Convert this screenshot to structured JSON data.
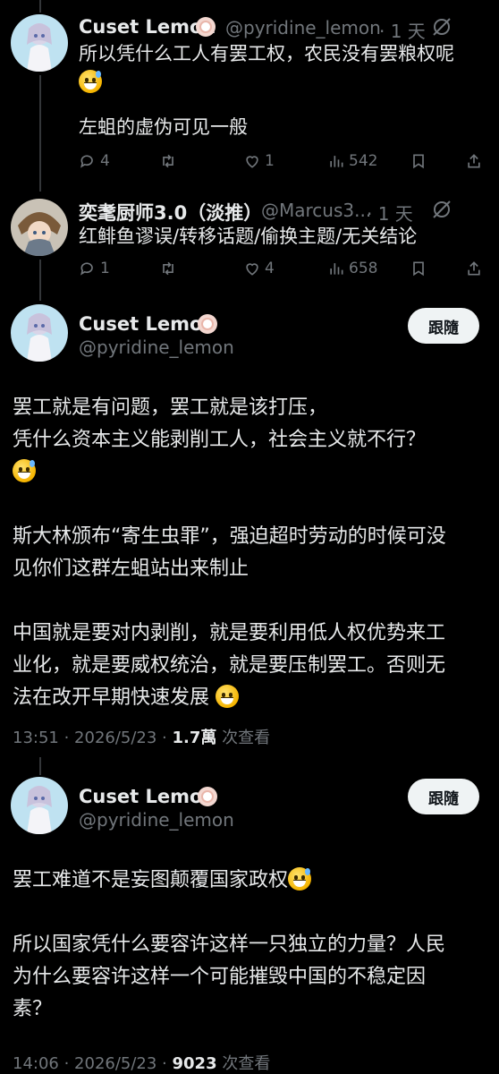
{
  "replies": [
    {
      "name": "Cuset Lemon",
      "handle": "@pyridine_lemon",
      "time": "· 1 天",
      "text_line1": "所以凭什么工人有罢工权，农民没有罢粮权呢",
      "text_line2": "左蛆的虚伪可见一般",
      "metrics": {
        "replies": "4",
        "retweets": "",
        "likes": "1",
        "views": "542"
      }
    },
    {
      "name": "奕耄厨师3.0（淡推）",
      "handle": "@Marcus3...",
      "time": "· 1 天",
      "text_line1": "红鲱鱼谬误/转移话题/偷换主题/无关结论",
      "metrics": {
        "replies": "1",
        "retweets": "",
        "likes": "4",
        "views": "658"
      }
    }
  ],
  "main_tweet": {
    "name": "Cuset Lemon",
    "handle": "@pyridine_lemon",
    "follow_label": "跟隨",
    "p1_line1": "罢工就是有问题，罢工就是该打压，",
    "p1_line2": "凭什么资本主义能剥削工人，社会主义就不行？",
    "p2_line1": "斯大林颁布“寄生虫罪”，强迫超时劳动的时候可没",
    "p2_line2": "见你们这群左蛆站出来制止",
    "p3_line1": "中国就是要对内剥削，就是要利用低人权优势来工",
    "p3_line2": "业化，就是要威权统治，就是要压制罢工。否则无",
    "p3_line3": "法在改开早期快速发展",
    "time": "13:51 · 2026/5/23 · ",
    "views": "1.7萬",
    "views_label": " 次查看"
  },
  "second_tweet": {
    "name": "Cuset Lemon",
    "handle": "@pyridine_lemon",
    "follow_label": "跟隨",
    "p1_line1": "罢工难道不是妄图颠覆国家政权",
    "p2_line1": "所以国家凭什么要容许这样一只独立的力量？人民",
    "p2_line2": "为什么要容许这样一个可能摧毁中国的不稳定因",
    "p2_line3": "素？",
    "time": "14:06 · 2026/5/23 · ",
    "views": "9023",
    "views_label": " 次查看"
  },
  "icons": [
    "reply-icon",
    "retweet-icon",
    "like-icon",
    "views-icon",
    "bookmark-icon",
    "share-icon",
    "grok-icon",
    "flower-badge-icon",
    "emoji-sweat-smile-icon",
    "emoji-smile-icon"
  ],
  "colors": {
    "background": "#000000",
    "text": "#e7e9ea",
    "muted": "#71767b",
    "button": "#eff3f4"
  }
}
